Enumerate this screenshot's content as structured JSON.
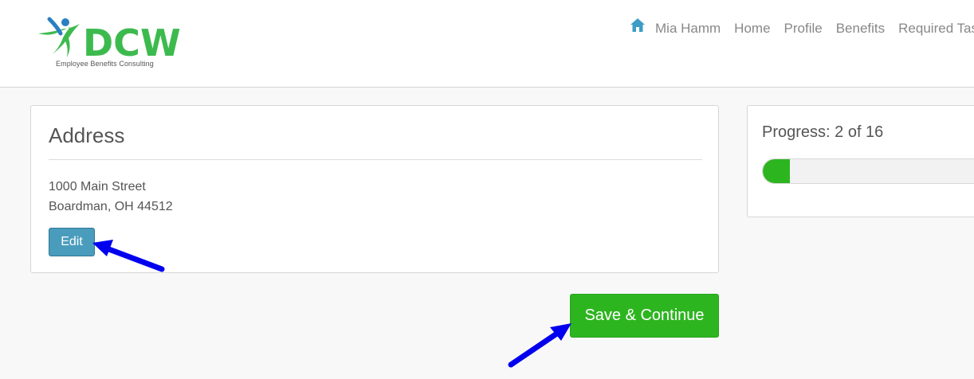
{
  "header": {
    "logo_text": "DCW",
    "logo_subtitle": "Employee Benefits Consulting",
    "user_name": "Mia Hamm",
    "nav_items": [
      "Home",
      "Profile",
      "Benefits",
      "Required Tasks"
    ],
    "brand_colors": {
      "blue": "#2a7fc1",
      "green": "#3dba4e"
    }
  },
  "address": {
    "title": "Address",
    "line1": "1000 Main Street",
    "line2": "Boardman, OH 44512",
    "edit_label": "Edit"
  },
  "progress": {
    "label": "Progress: 2 of 16",
    "current": 2,
    "total": 16
  },
  "actions": {
    "save_label": "Save & Continue"
  },
  "colors": {
    "primary_green": "#2db520",
    "edit_blue": "#4a9cbd",
    "annotation_arrow": "#0000ee"
  }
}
